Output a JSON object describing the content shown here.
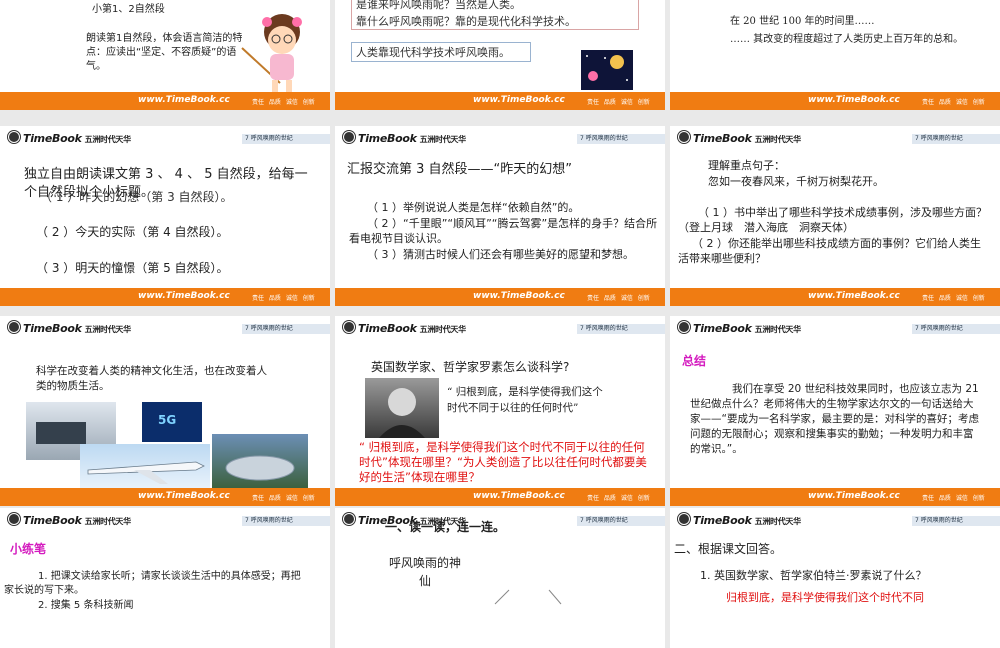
{
  "brand": {
    "logo_en": "TimeBook",
    "logo_cn": "五洲时代天华",
    "url": "www.TimeBook.cc",
    "tags": "责任 品质 诚信 创新",
    "lesson_tab": "7  呼风唤雨的世纪"
  },
  "s1": {
    "top_fragment": "小第1、2自然段",
    "note": "朗读第1自然段，体会语言简洁的特点：应读出“坚定、不容质疑”的语气。"
  },
  "s2": {
    "box_line1": "是谁来呼风唤雨呢？当然是人类。",
    "box_line2": "靠什么呼风唤雨呢？靠的是现代化科学技术。",
    "answer": "人类靠现代科学技术呼风唤雨。"
  },
  "s3": {
    "line1": "在 20 世纪 100 年的时间里……",
    "line2": "…… 其改变的程度超过了人类历史上百万年的总和。"
  },
  "s4": {
    "title": "独立自由朗读课文第 3 、 4 、 5 自然段，给每一个自然段拟个小标题。",
    "item1": "（ 1 ）昨天的幻想（第 3 自然段）。",
    "item2": "（ 2 ）今天的实际（第 4 自然段）。",
    "item3": "（ 3 ）明天的憧憬（第 5 自然段）。"
  },
  "s5": {
    "title": "汇报交流第 3 自然段——“昨天的幻想”",
    "q1": "（ 1 ）举例说说人类是怎样“依赖自然”的。",
    "q2": "（ 2 ）“千里眼”“顺风耳”“腾云驾雾”是怎样的身手？结合所看电视节目谈认识。",
    "q3": "（ 3 ）猜测古时候人们还会有哪些美好的愿望和梦想。"
  },
  "s6": {
    "p1": "理解重点句子：",
    "p2": "忽如一夜春风来，千树万树梨花开。",
    "p3": "（ 1 ）书中举出了哪些科学技术成绩事例，涉及哪些方面？ （登上月球　潜入海底　洞察天体）",
    "p4": "（ 2 ）你还能举出哪些科技成绩方面的事例？它们给人类生活带来哪些便利？"
  },
  "s7": {
    "text": "科学在改变着人类的精神文化生活，也在改变着人类的物质生活。",
    "badge": "5G"
  },
  "s8": {
    "title": "英国数学家、哲学家罗素怎么谈科学?",
    "quote": "“ 归根到底，是科学使得我们这个时代不同于以往的任何时代”",
    "red_text": "“ 归根到底，是科学使得我们这个时代不同于以往的任何时代”体现在哪里？“为人类创造了比以往任何时代都要美好的生活”体现在哪里？"
  },
  "s9": {
    "heading": "总结",
    "body": "我们在享受 20 世纪科技效果同时，也应该立志为 21 世纪做点什么？老师将伟大的生物学家达尔文的一句话送给大家——“要成为一名科学家，最主要的是：对科学的喜好；考虑问题的无限耐心；观察和搜集事实的勤勉；一种发明力和丰富的常识。”。"
  },
  "s10": {
    "heading": "小练笔",
    "p1": "1. 把课文读给家长听；请家长谈谈生活中的具体感受；再把家长说的写下来。",
    "p2": "2. 搜集 5 条科技新闻"
  },
  "s11": {
    "heading": "一、读一读，连一连。",
    "word": "呼风唤雨的神仙"
  },
  "s12": {
    "heading": "二、根据课文回答。",
    "q1": "1. 英国数学家、哲学家伯特兰·罗素说了什么？",
    "a1": "归根到底，是科学使得我们这个时代不同"
  }
}
